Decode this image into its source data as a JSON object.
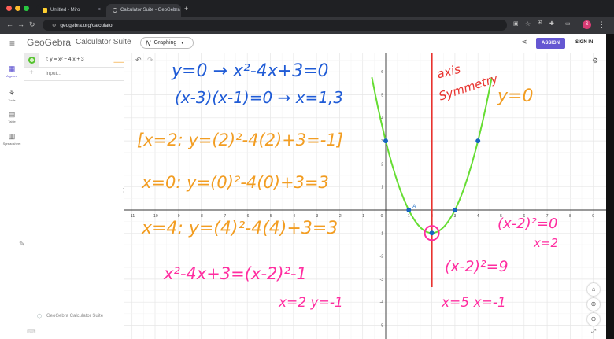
{
  "browser": {
    "tabs": [
      {
        "title": "Untitled - Miro",
        "active": false
      },
      {
        "title": "Calculator Suite - GeoGebra",
        "active": true
      }
    ],
    "new_tab": "+",
    "url": "geogebra.org/calculator",
    "profile_initial": "S"
  },
  "header": {
    "logo": "GeoGebra",
    "app_name": "Calculator Suite",
    "mode": "Graphing",
    "assign_label": "ASSIGN",
    "signin_label": "SIGN IN"
  },
  "nav": [
    {
      "label": "Algebra",
      "icon": "calculator-icon",
      "active": true
    },
    {
      "label": "Tools",
      "icon": "tools-icon",
      "active": false
    },
    {
      "label": "Table",
      "icon": "table-icon",
      "active": false
    },
    {
      "label": "Spreadsheet",
      "icon": "spreadsheet-icon",
      "active": false
    }
  ],
  "algebra": {
    "function": "f: y = x² − 4 x + 3",
    "input_placeholder": "Input...",
    "footer": "GeoGebra Calculator Suite"
  },
  "graph": {
    "x_ticks": [
      -11,
      -10,
      -9,
      -8,
      -7,
      -6,
      -5,
      -4,
      -3,
      -2,
      -1,
      0,
      1,
      2,
      3,
      4,
      5,
      6,
      7,
      8,
      9
    ],
    "y_ticks": [
      6,
      5,
      4,
      3,
      2,
      1,
      -1,
      -2,
      -3,
      -4,
      -5
    ],
    "point_labels": [
      "A"
    ],
    "colors": {
      "curve": "#66dd33",
      "axis_line": "#e8332f",
      "points": "#1565c0",
      "pink": "#ff2da0",
      "blue": "#1f5bd6",
      "orange": "#f29d22"
    }
  },
  "annotations": {
    "blue_line1": "y=0 → x²-4x+3=0",
    "blue_line2": "(x-3)(x-1)=0 → x=1,3",
    "orange_line1": "[x=2: y=(2)²-4(2)+3=-1]",
    "orange_line2": "x=0: y=(0)²-4(0)+3=3",
    "orange_line3": "x=4: y=(4)²-4(4)+3=3",
    "orange_y0": "y=0",
    "red_axis1": "axis",
    "red_axis2": "Symmetry",
    "pink_complete": "x²-4x+3=(x-2)²-1",
    "pink_vertex": "x=2   y=-1",
    "pink_eq0": "(x-2)²=0",
    "pink_x2": "x=2",
    "pink_eq9": "(x-2)²=9",
    "pink_sol": "x=5   x=-1"
  }
}
